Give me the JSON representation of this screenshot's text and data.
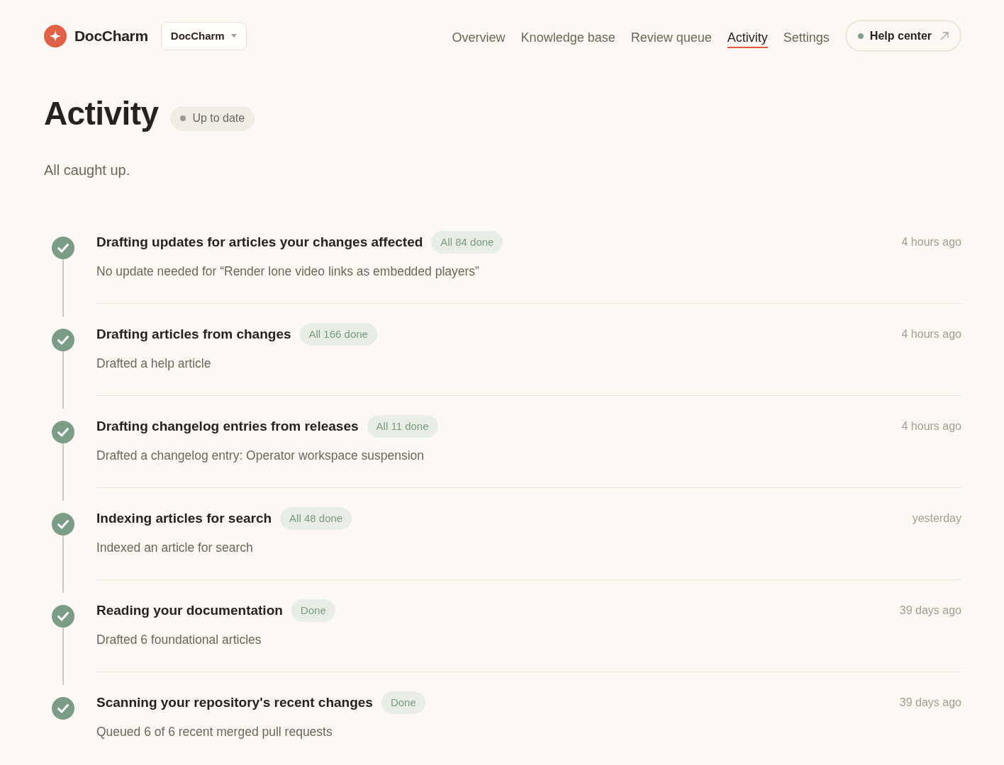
{
  "header": {
    "brand": {
      "name": "DocCharm"
    },
    "workspace_switcher": {
      "label": "DocCharm"
    },
    "nav": [
      {
        "label": "Overview",
        "selected": false
      },
      {
        "label": "Knowledge base",
        "selected": false
      },
      {
        "label": "Review queue",
        "selected": false
      },
      {
        "label": "Activity",
        "selected": true
      },
      {
        "label": "Settings",
        "selected": false
      }
    ],
    "help_link": {
      "label": "Help center"
    }
  },
  "page": {
    "title": "Activity",
    "status_badge": "Up to date",
    "summary": "All caught up."
  },
  "activity": [
    {
      "title": "Drafting updates for articles your changes affected",
      "badge": "All 84 done",
      "description": "No update needed for “Render lone video links as embedded players”",
      "time": "4 hours ago",
      "done": true
    },
    {
      "title": "Drafting articles from changes",
      "badge": "All 166 done",
      "description": "Drafted a help article",
      "time": "4 hours ago",
      "done": true
    },
    {
      "title": "Drafting changelog entries from releases",
      "badge": "All 11 done",
      "description": "Drafted a changelog entry: Operator workspace suspension",
      "time": "4 hours ago",
      "done": true
    },
    {
      "title": "Indexing articles for search",
      "badge": "All 48 done",
      "description": "Indexed an article for search",
      "time": "yesterday",
      "done": true
    },
    {
      "title": "Reading your documentation",
      "badge": "Done",
      "description": "Drafted 6 foundational articles",
      "time": "39 days ago",
      "done": true
    },
    {
      "title": "Scanning your repository's recent changes",
      "badge": "Done",
      "description": "Queued 6 of 6 recent merged pull requests",
      "time": "39 days ago",
      "done": true
    }
  ]
}
